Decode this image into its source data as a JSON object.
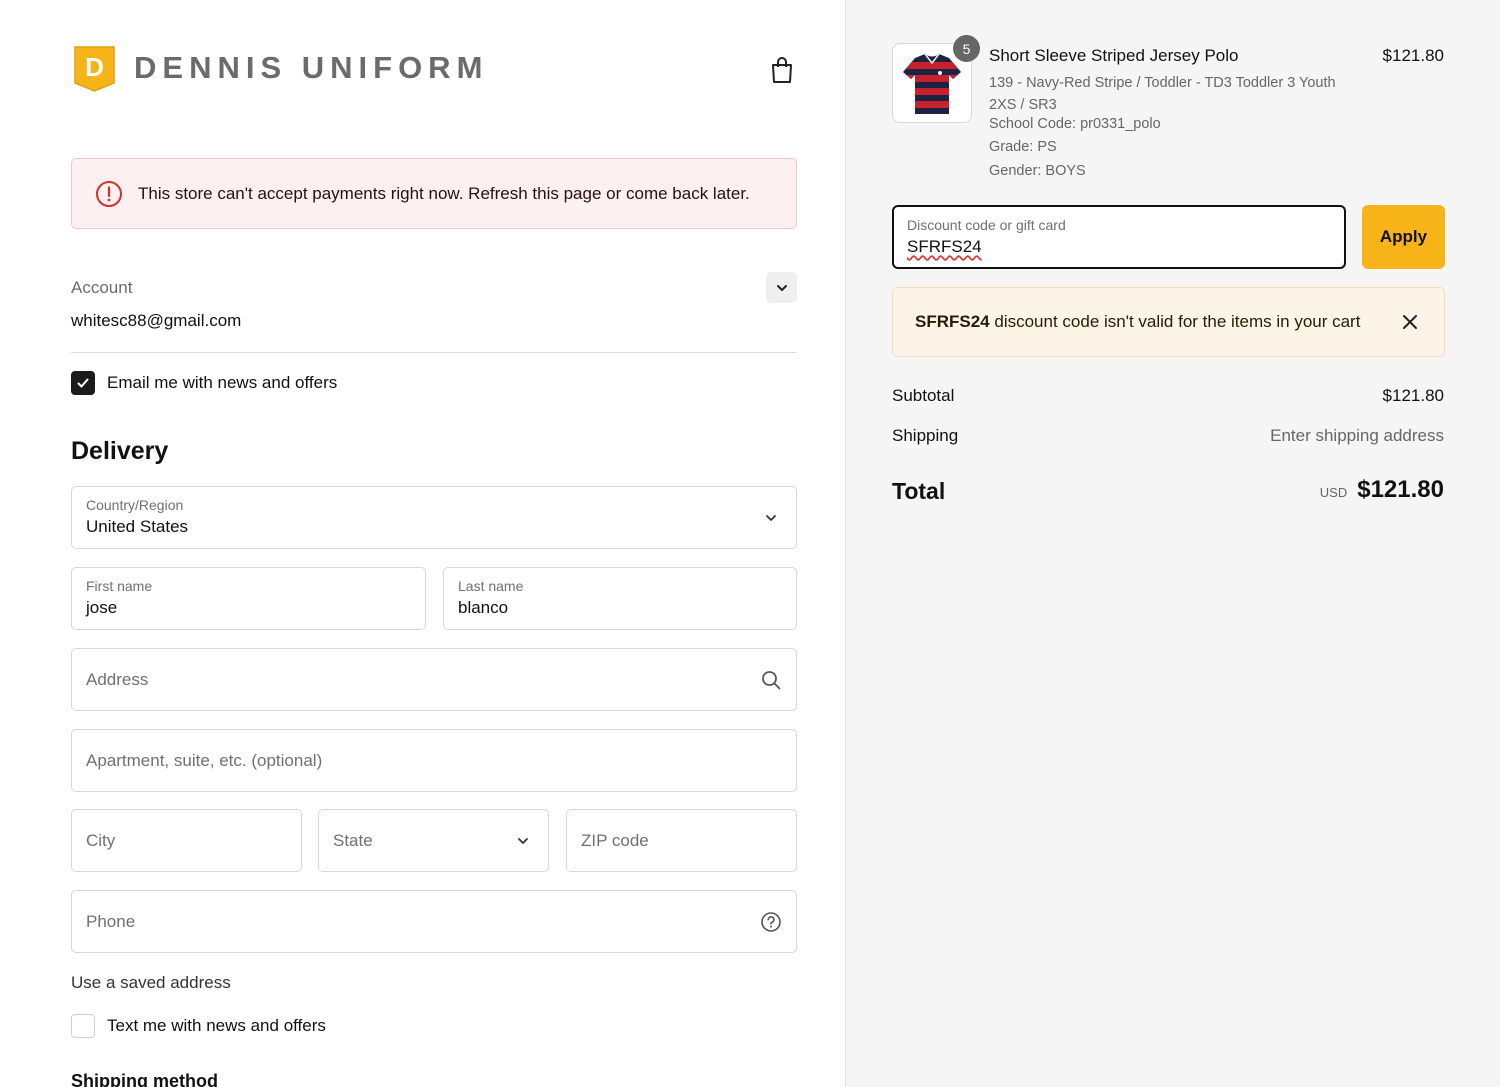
{
  "header": {
    "brand_letter": "D",
    "brand_name": "DENNIS UNIFORM",
    "cart_icon": "shopping-bag-icon",
    "brand_color": "#f7b418"
  },
  "alert": {
    "icon": "alert-circle-icon",
    "message": "This store can't accept payments right now. Refresh this page or come back later."
  },
  "account": {
    "label": "Account",
    "email": "whitesc88@gmail.com",
    "toggle_icon": "chevron-down-icon"
  },
  "email_opt_in": {
    "label": "Email me with news and offers",
    "checked": true
  },
  "delivery": {
    "title": "Delivery",
    "country": {
      "label": "Country/Region",
      "value": "United States"
    },
    "first_name": {
      "label": "First name",
      "value": "jose"
    },
    "last_name": {
      "label": "Last name",
      "value": "blanco"
    },
    "address": {
      "placeholder": "Address"
    },
    "apartment": {
      "placeholder": "Apartment, suite, etc. (optional)"
    },
    "city": {
      "placeholder": "City"
    },
    "state": {
      "placeholder": "State"
    },
    "zip": {
      "placeholder": "ZIP code"
    },
    "phone": {
      "placeholder": "Phone"
    },
    "saved_address_link": "Use a saved address",
    "sms_opt_in": {
      "label": "Text me with news and offers",
      "checked": false
    }
  },
  "shipping_method": {
    "title": "Shipping method"
  },
  "cart": {
    "item": {
      "quantity": "5",
      "name": "Short Sleeve Striped Jersey Polo",
      "price": "$121.80",
      "variant": "139 - Navy-Red Stripe / Toddler - TD3 Toddler 3 Youth 2XS / SR3",
      "school_code": "School Code: pr0331_polo",
      "grade": "Grade: PS",
      "gender": "Gender: BOYS"
    },
    "discount": {
      "label": "Discount code or gift card",
      "value": "SFRFS24",
      "apply_label": "Apply"
    },
    "discount_warning": {
      "code": "SFRFS24",
      "message": " discount code isn't valid for the items in your cart",
      "close_icon": "close-icon"
    },
    "subtotal": {
      "label": "Subtotal",
      "value": "$121.80"
    },
    "shipping": {
      "label": "Shipping",
      "value": "Enter shipping address"
    },
    "total": {
      "label": "Total",
      "currency": "USD",
      "value": "$121.80"
    }
  }
}
